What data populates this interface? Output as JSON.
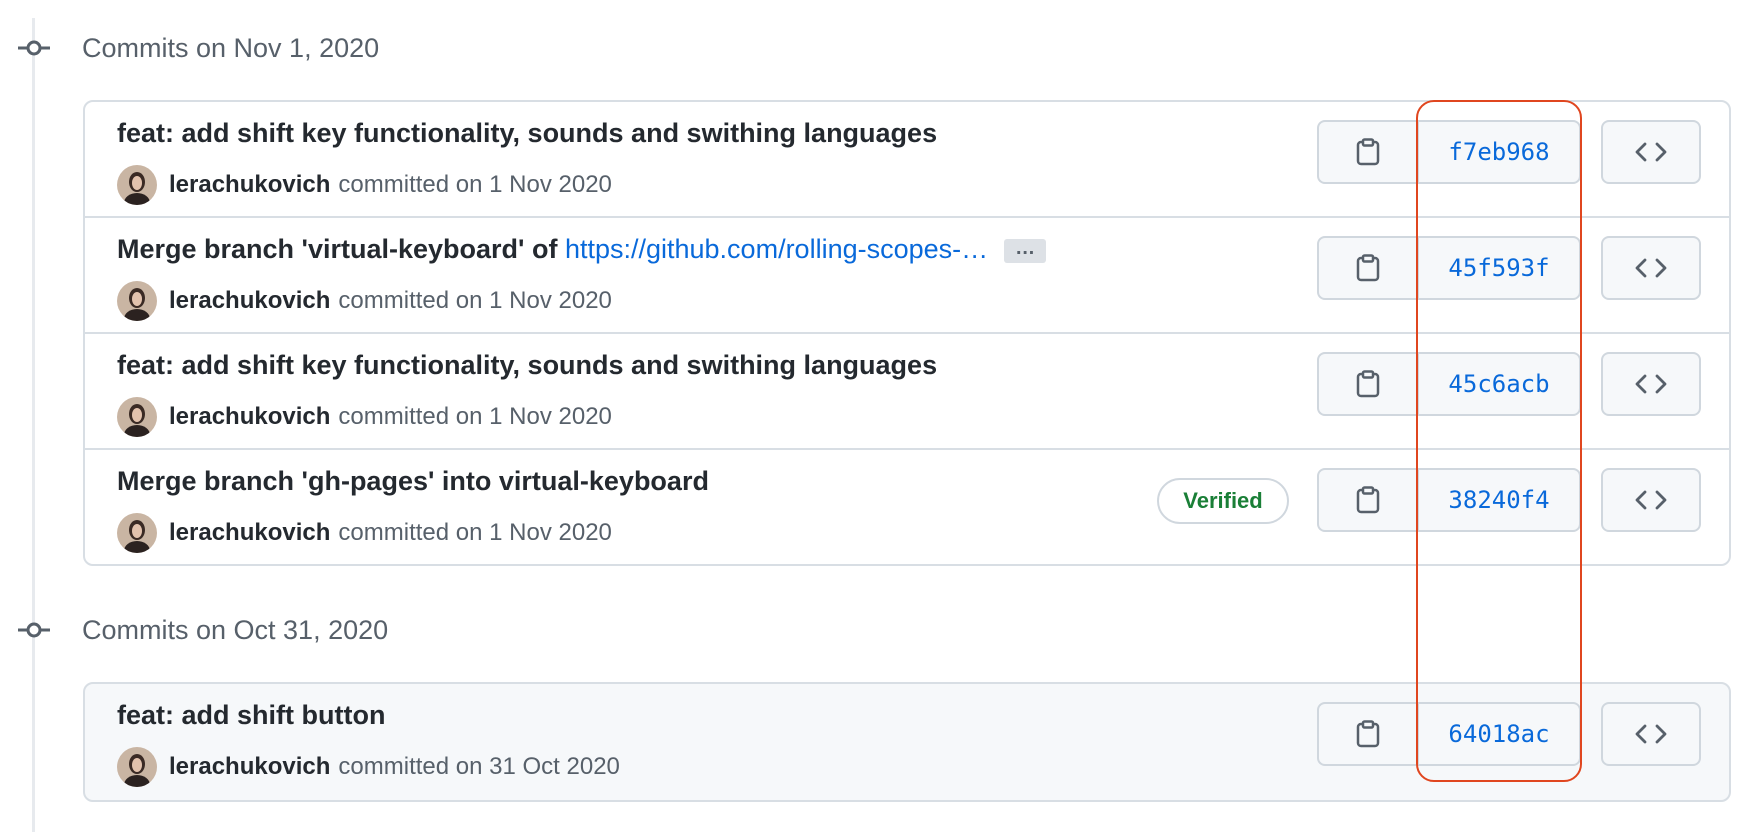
{
  "groups": [
    {
      "title": "Commits on Nov 1, 2020",
      "commits": [
        {
          "title": "feat: add shift key functionality, sounds and swithing languages",
          "author": "lerachukovich",
          "committed": "committed on 1 Nov 2020",
          "sha": "f7eb968"
        },
        {
          "title": "Merge branch 'virtual-keyboard' of ",
          "title_link": "https://github.com/rolling-scopes-…",
          "ellipsis": "…",
          "author": "lerachukovich",
          "committed": "committed on 1 Nov 2020",
          "sha": "45f593f"
        },
        {
          "title": "feat: add shift key functionality, sounds and swithing languages",
          "author": "lerachukovich",
          "committed": "committed on 1 Nov 2020",
          "sha": "45c6acb"
        },
        {
          "title": "Merge branch 'gh-pages' into virtual-keyboard",
          "verified": "Verified",
          "author": "lerachukovich",
          "committed": "committed on 1 Nov 2020",
          "sha": "38240f4"
        }
      ]
    },
    {
      "title": "Commits on Oct 31, 2020",
      "commits": [
        {
          "title": "feat: add shift button",
          "author": "lerachukovich",
          "committed": "committed on 31 Oct 2020",
          "sha": "64018ac"
        }
      ]
    }
  ],
  "icons": {
    "commit": "git-commit-icon",
    "copy": "clipboard-icon",
    "browse": "code-icon"
  },
  "colors": {
    "link": "#0969da",
    "verified": "#1a7f37",
    "highlight": "#e0461f"
  }
}
